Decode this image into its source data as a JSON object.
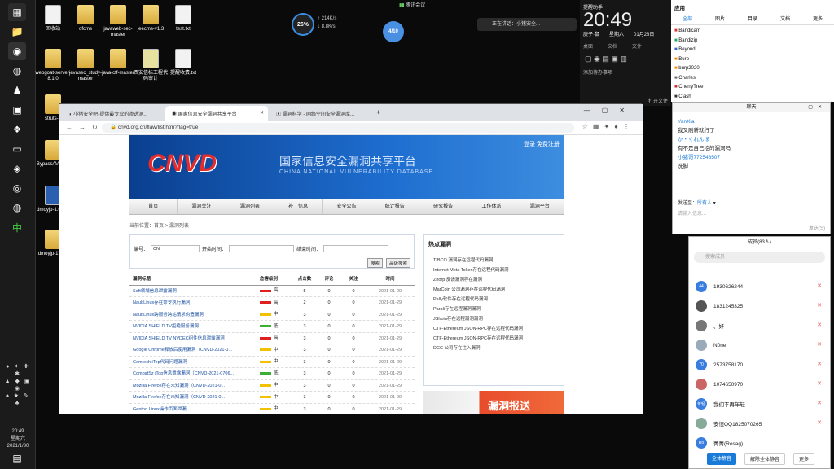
{
  "taskbar": {
    "time": "20:49",
    "weekday": "星期六",
    "date": "2021/1/30"
  },
  "desktop_icons": [
    {
      "label": "回收站",
      "kind": "file"
    },
    {
      "label": "ofcms",
      "kind": "folder"
    },
    {
      "label": "javaweb-sec-master",
      "kind": "folder"
    },
    {
      "label": "jeecms-v1.3",
      "kind": "folder"
    },
    {
      "label": "test.txt",
      "kind": "file"
    },
    {
      "label": "webgoat-server-8.1.0",
      "kind": "folder"
    },
    {
      "label": "javasec_study-master",
      "kind": "folder"
    },
    {
      "label": "java-ctf-master",
      "kind": "folder"
    },
    {
      "label": "西安信标工程代码审计",
      "kind": "file"
    },
    {
      "label": "提醒收费.txt",
      "kind": "file"
    },
    {
      "label": "struts-2",
      "kind": "folder"
    },
    {
      "label": "BypassAV...run",
      "kind": "folder"
    },
    {
      "label": "dmoyjp-1.0125",
      "kind": "folder"
    },
    {
      "label": "dmoyjp-1.012",
      "kind": "folder"
    }
  ],
  "topbar": {
    "meeting": "腾讯会议",
    "speaking": "正在讲话：小猪安全...",
    "net_percent": "26%",
    "net_up": "↑ 214K/s",
    "net_down": "↓ 8.8K/s",
    "badge": "4/10"
  },
  "clock": {
    "label": "提醒助手",
    "time": "20:49",
    "weekday": "庚子·鼠",
    "day": "星期六",
    "date": "01月28日",
    "tabs": [
      "桌面",
      "文档",
      "文件"
    ],
    "add": "添加待办事项",
    "open": "打开文件"
  },
  "right_panel": {
    "title": "应用",
    "tabs": [
      "全部",
      "图片",
      "目录",
      "文档",
      "更多"
    ],
    "items": [
      "Bandicam",
      "Bandizip",
      "Beyond",
      "Burp",
      "burp2020",
      "Charles",
      "CherryTree",
      "Clash"
    ]
  },
  "chat": {
    "title": "聊天",
    "messages": [
      {
        "from": "YanXia",
        "text": "我又刷新就行了"
      },
      {
        "from": "",
        "text": "か・くれんぼ"
      },
      {
        "from": "",
        "text": "有不是自己挖的漏洞吗"
      },
      {
        "from": "小猪哥772548507",
        "text": "洗脚"
      }
    ],
    "send_to_label": "发送至：",
    "send_to": "所有人",
    "placeholder": "请输入信息...",
    "send": "发送(S)"
  },
  "members": {
    "title": "成员(83人)",
    "search": "搜索成员",
    "list": [
      {
        "name": "1930626244",
        "av": "44"
      },
      {
        "name": "1831245325",
        "av": ""
      },
      {
        "name": "、好",
        "av": ""
      },
      {
        "name": "N0ne",
        "av": ""
      },
      {
        "name": "2573758170",
        "av": "70"
      },
      {
        "name": "1074650970",
        "av": ""
      },
      {
        "name": "我们不再年轻",
        "av": "年轻"
      },
      {
        "name": "安恒QQ1825070265",
        "av": ""
      },
      {
        "name": "菁菁(Rosag)",
        "av": "Ro"
      }
    ],
    "mute_all": "全体静音",
    "unmute_all": "解除全体静音",
    "more": "更多"
  },
  "browser": {
    "tabs": [
      "小猪安全吧-提供最专业的渗透测...",
      "国家信息安全漏洞共享平台",
      "漏洞科学 - 网络空间安全漏洞库..."
    ],
    "url": "cnvd.org.cn/flaw/list.htm?flag=true",
    "site": {
      "logo": "CNVD",
      "title_cn": "国家信息安全漏洞共享平台",
      "title_en": "CHINA NATIONAL VULNERABILITY DATABASE",
      "login": "登录",
      "register": "免费注册"
    },
    "nav": [
      "首页",
      "漏洞关注",
      "漏洞列表",
      "补丁信息",
      "安全公告",
      "统计报告",
      "研究报告",
      "工作体系",
      "漏洞平台"
    ],
    "breadcrumb": "当前位置：首页 > 漏洞列表",
    "search": {
      "label_no": "编号：",
      "value_no": "CN",
      "label_start": "开始时间：",
      "label_end": "结束时间：",
      "query": "搜索",
      "advanced": "高级搜索"
    },
    "table_headers": [
      "漏洞标题",
      "危害级别",
      "点击数",
      "评论",
      "关注",
      "时间"
    ],
    "rows": [
      {
        "t": "Soft领域信息泄露漏洞",
        "lvl": "高",
        "color": "#e02020",
        "c": "5",
        "r": "0",
        "f": "0",
        "d": "2021-01-29"
      },
      {
        "t": "NaubLinux存在命令执行漏洞",
        "lvl": "高",
        "color": "#e02020",
        "c": "2",
        "r": "0",
        "f": "0",
        "d": "2021-01-29"
      },
      {
        "t": "NaubLinux跨服务跨站请求伪造漏洞",
        "lvl": "中",
        "color": "#f2c200",
        "c": "3",
        "r": "0",
        "f": "0",
        "d": "2021-01-29"
      },
      {
        "t": "NVIDIA SHIELD TV拒绝服务漏洞",
        "lvl": "低",
        "color": "#3cb034",
        "c": "3",
        "r": "0",
        "f": "0",
        "d": "2021-01-29"
      },
      {
        "t": "NVIDIA SHIELD TV NVDEC组件信息泄露漏洞",
        "lvl": "高",
        "color": "#e02020",
        "c": "3",
        "r": "0",
        "f": "0",
        "d": "2021-01-29"
      },
      {
        "t": "Google Chrome释放后使用漏洞（CNVD-2021-0...",
        "lvl": "中",
        "color": "#f2c200",
        "c": "3",
        "r": "0",
        "f": "0",
        "d": "2021-01-29"
      },
      {
        "t": "Cemtech iTop代码问题漏洞",
        "lvl": "中",
        "color": "#f2c200",
        "c": "3",
        "r": "0",
        "f": "0",
        "d": "2021-01-29"
      },
      {
        "t": "CombatSz iTop信息泄露漏洞（CNVD-2021-0706...",
        "lvl": "低",
        "color": "#3cb034",
        "c": "3",
        "r": "0",
        "f": "0",
        "d": "2021-01-29"
      },
      {
        "t": "Mozilla Firefox存在未知漏洞（CNVD-2021-0...",
        "lvl": "中",
        "color": "#f2c200",
        "c": "3",
        "r": "0",
        "f": "0",
        "d": "2021-01-29"
      },
      {
        "t": "Mozilla Firefox存在未知漏洞（CNVD-2021-0...",
        "lvl": "中",
        "color": "#f2c200",
        "c": "3",
        "r": "0",
        "f": "0",
        "d": "2021-01-29"
      },
      {
        "t": "Gentoo Linux操作页面泄漏",
        "lvl": "中",
        "color": "#f2c200",
        "c": "3",
        "r": "0",
        "f": "0",
        "d": "2021-01-29"
      }
    ],
    "hot_title": "热点漏洞",
    "hot": [
      "TIBCO 漏洞存在远程代码漏洞",
      "Internet Meta Token存在远程代码漏洞",
      "Zhorp 反馈漏洞存在漏洞",
      "MarCoin 公司漏洞存在远程代码漏洞",
      "Pally软件存在远程代码漏洞",
      "Parali存在远程漏洞漏洞",
      "JShoin存在远程漏洞漏洞",
      "CTF-Ethereum JSON-RPC存在远程代码漏洞",
      "CTF-Ethereum JSON-RPC存在远程代码漏洞",
      "DCC 公司存在注入漏洞"
    ],
    "report": "漏洞报送"
  }
}
